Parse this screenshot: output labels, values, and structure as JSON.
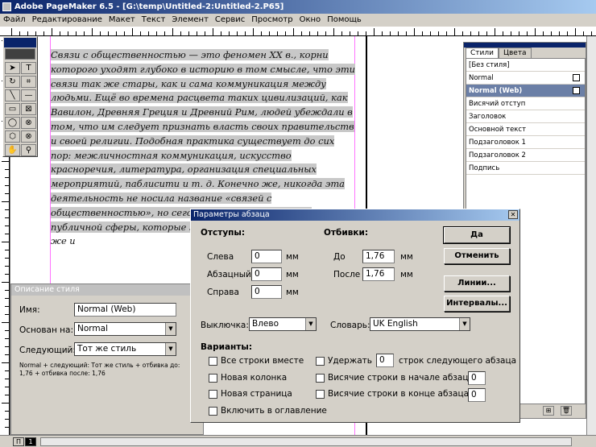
{
  "window": {
    "title": "Adobe PageMaker 6.5 - [G:\\temp\\Untitled-2:Untitled-2.P65]"
  },
  "menu": [
    "Файл",
    "Редактирование",
    "Макет",
    "Текст",
    "Элемент",
    "Сервис",
    "Просмотр",
    "Окно",
    "Помощь"
  ],
  "body_text": "Связи с общественностью — это феномен XX в., корни которого уходят глубоко в историю в том смысле, что эти связи так же стары, как и сама коммуникация между людьми. Ещё во времена расцвета таких цивилизаций, как Вавилон, Древняя Греция и Древний Рим, людей убеждали в том, что им следует признать власть своих правительств и своей религии. Подобная практика существует до сих пор: межличностная коммуникация, искусство красноречия, литература, организация специальных мероприятий, паблисити и т. д. Конечно же, никогда эта деятельность не носила название «связей с общественностью», но сегодня перед работниками публичной сферы, которые за",
  "body_text_tail": "деятельностью, стоятте же и",
  "styles_palette": {
    "tabs": [
      "Стили",
      "Цвета"
    ],
    "items": [
      "[Без стиля]",
      "Normal",
      "Normal (Web)",
      "Висячий отступ",
      "Заголовок",
      "Основной текст",
      "Подзаголовок 1",
      "Подзаголовок 2",
      "Подпись"
    ],
    "selected": "Normal (Web)"
  },
  "style_desc": {
    "title": "Описание стиля",
    "name_label": "Имя:",
    "name_value": "Normal (Web)",
    "based_label": "Основан на:",
    "based_value": "Normal",
    "next_label": "Следующий:",
    "next_value": "Тот же стиль",
    "description": "Normal + следующий: Тот же стиль + отбивка до: 1,76 + отбивка после: 1,76"
  },
  "dialog": {
    "title": "Параметры абзаца",
    "indents_label": "Отступы:",
    "spacing_label": "Отбивки:",
    "left_label": "Слева",
    "left_value": "0",
    "first_label": "Абзацный",
    "first_value": "0",
    "right_label": "Справа",
    "right_value": "0",
    "before_label": "До",
    "before_value": "1,76",
    "after_label": "После",
    "after_value": "1,76",
    "unit": "мм",
    "ok": "Да",
    "cancel": "Отменить",
    "rules": "Линии...",
    "spacing": "Интервалы...",
    "align_label": "Выключка:",
    "align_value": "Влево",
    "dict_label": "Словарь:",
    "dict_value": "UK English",
    "options_label": "Варианты:",
    "opt_keep_together": "Все строки вместе",
    "opt_keep_with": "Удержать",
    "keep_with_value": "0",
    "keep_with_suffix": "строк следующего абзаца",
    "opt_column": "Новая колонка",
    "opt_widow": "Висячие строки в начале абзаца:",
    "widow_value": "0",
    "opt_page": "Новая страница",
    "opt_orphan": "Висячие строки в конце абзаца:",
    "orphan_value": "0",
    "opt_toc": "Включить в оглавление"
  },
  "status": {
    "page_l": "П",
    "page_1": "1"
  }
}
